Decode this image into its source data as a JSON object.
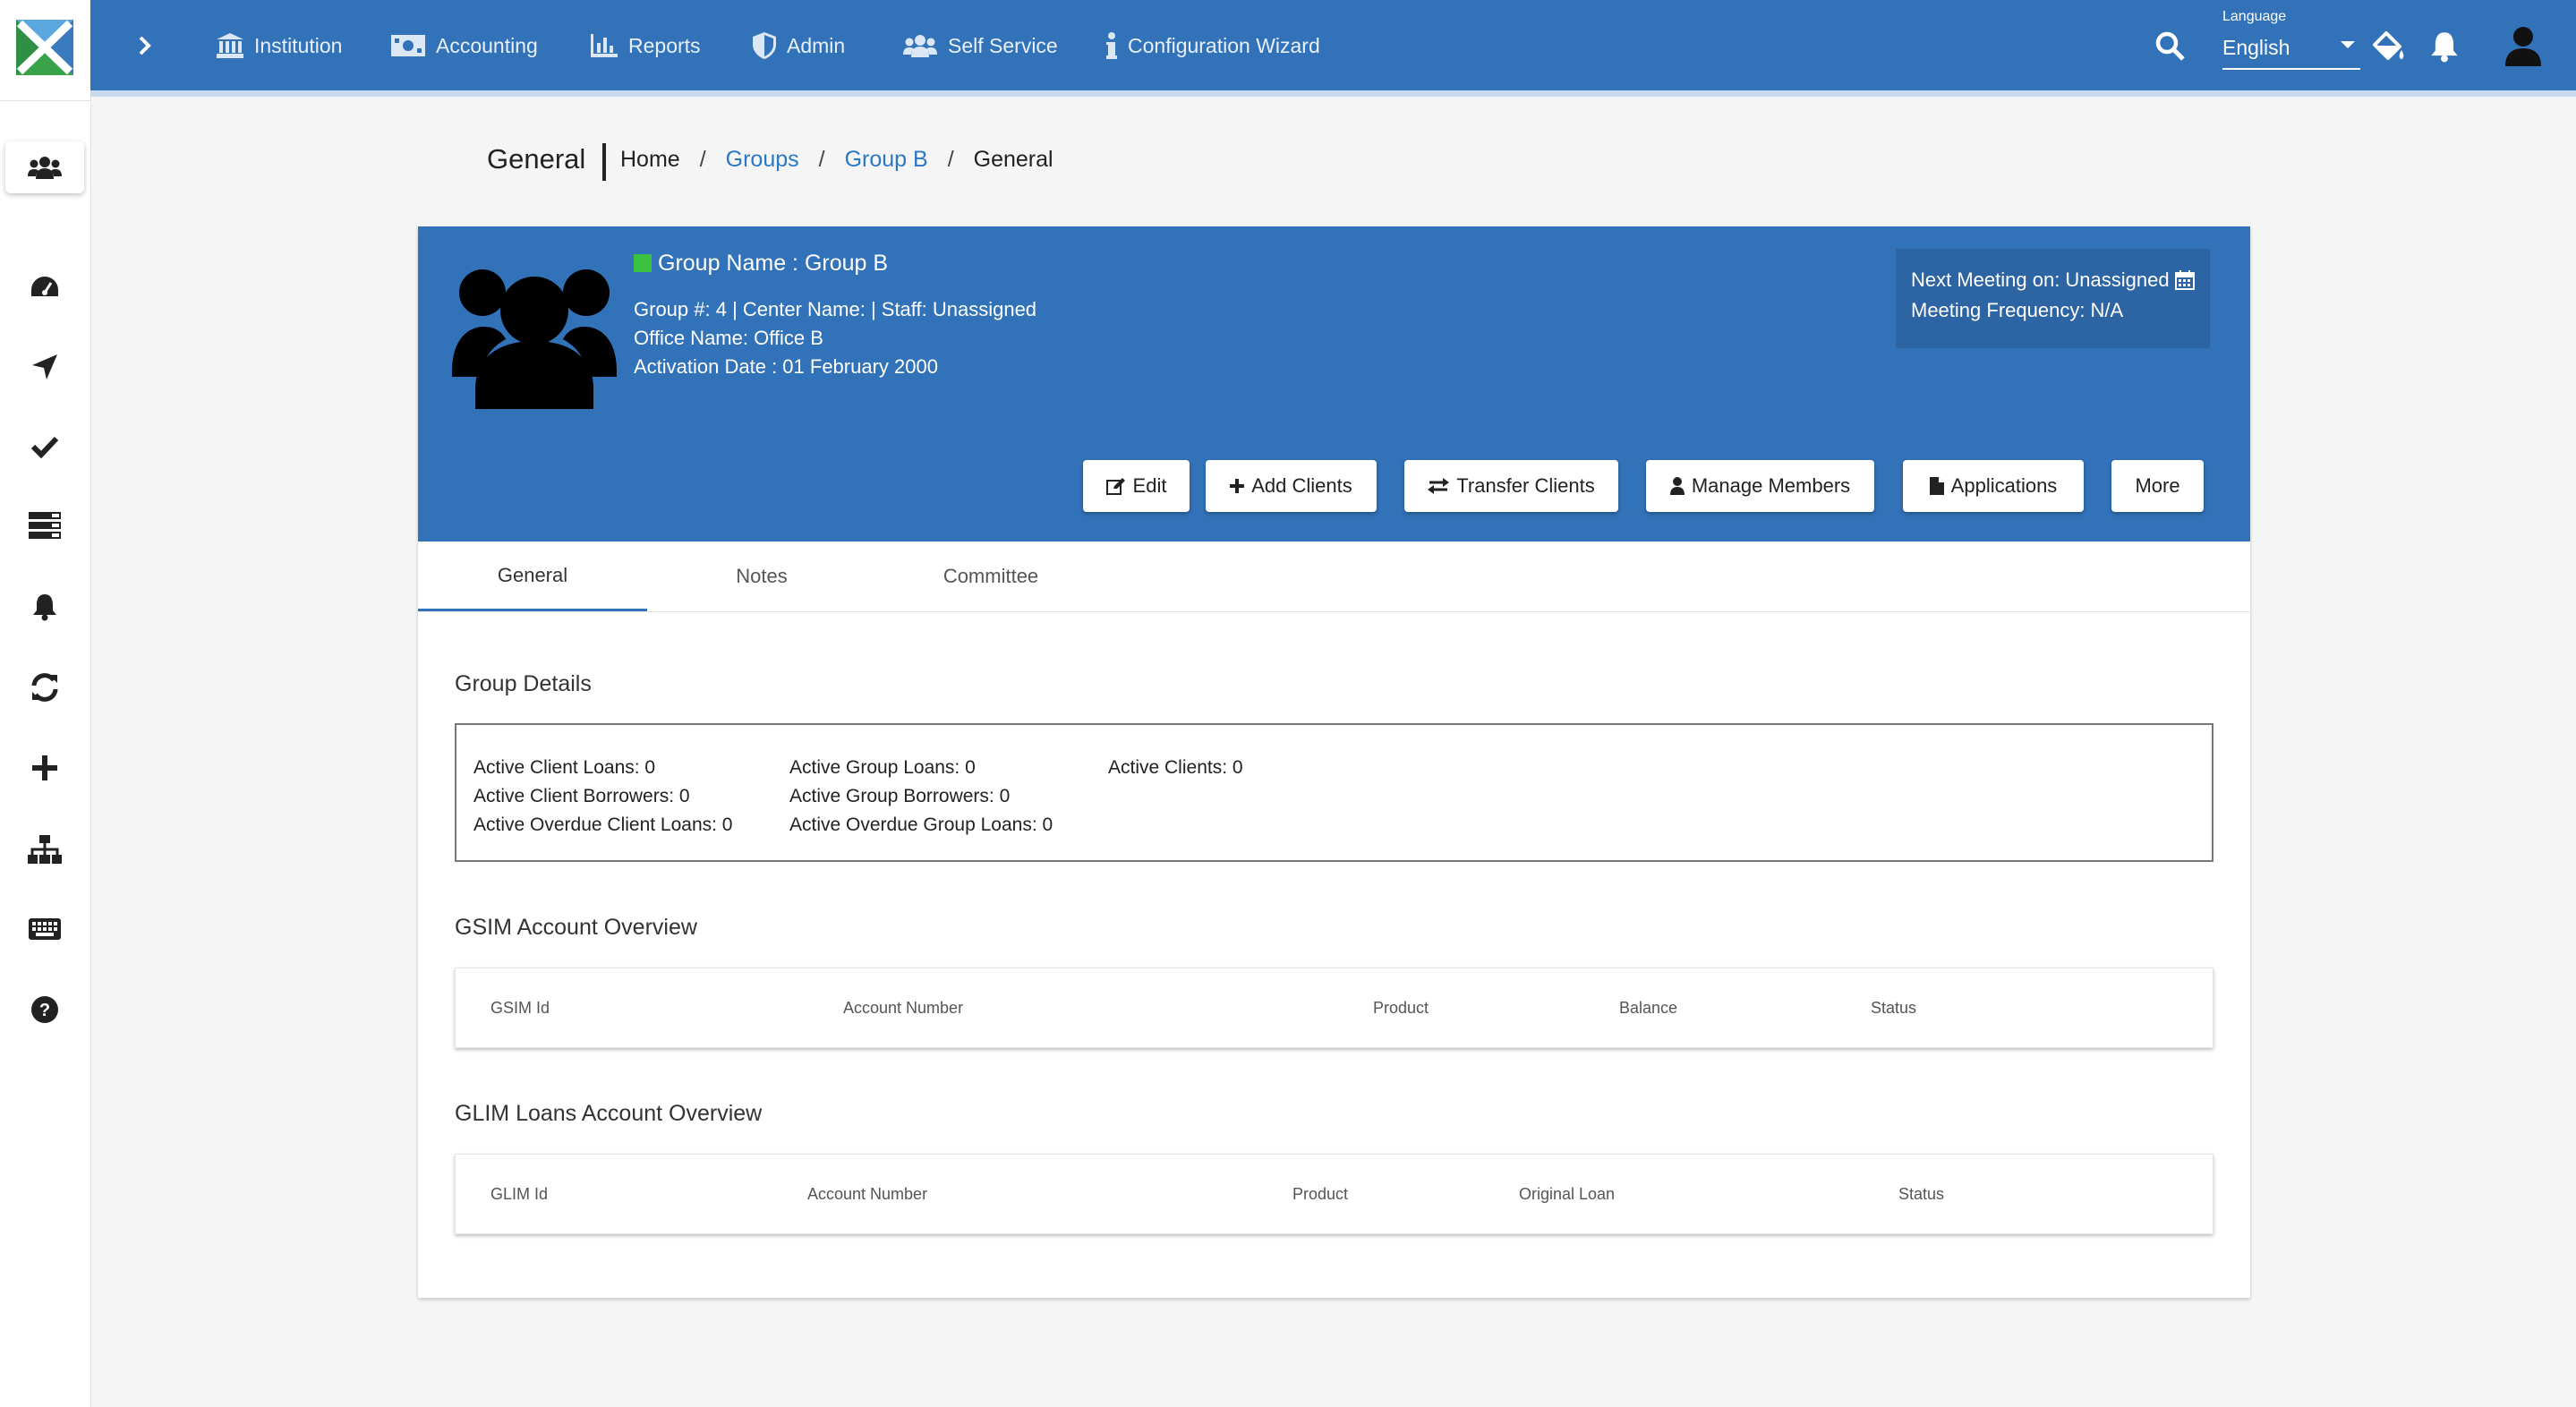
{
  "topbar": {
    "nav": [
      {
        "label": "Institution",
        "icon": "institution-icon"
      },
      {
        "label": "Accounting",
        "icon": "money-icon"
      },
      {
        "label": "Reports",
        "icon": "bar-chart-icon"
      },
      {
        "label": "Admin",
        "icon": "shield-icon"
      },
      {
        "label": "Self Service",
        "icon": "users-icon"
      },
      {
        "label": "Configuration Wizard",
        "icon": "info-icon"
      }
    ],
    "language_label": "Language",
    "language_value": "English"
  },
  "sidebar": {
    "icons": [
      "users-icon",
      "dashboard-icon",
      "navigate-icon",
      "check-icon",
      "list-icon",
      "bell-icon",
      "sync-icon",
      "plus-icon",
      "sitemap-icon",
      "keyboard-icon",
      "help-icon"
    ]
  },
  "page": {
    "title": "General",
    "breadcrumb": [
      "Home",
      "Groups",
      "Group B",
      "General"
    ]
  },
  "group": {
    "name_line": "Group Name : Group B",
    "line1": "Group #: 4 | Center Name: | Staff: Unassigned",
    "line2": "Office Name: Office B",
    "line3": "Activation Date : 01 February 2000",
    "next_meeting": "Next Meeting on: Unassigned",
    "meeting_frequency": "Meeting Frequency: N/A",
    "status_color": "#3ac23f"
  },
  "actions": {
    "edit": "Edit",
    "add_clients": "Add Clients",
    "transfer_clients": "Transfer Clients",
    "manage_members": "Manage Members",
    "applications": "Applications",
    "more": "More"
  },
  "tabs": [
    "General",
    "Notes",
    "Committee"
  ],
  "group_details": {
    "title": "Group Details",
    "col1": [
      "Active Client Loans: 0",
      "Active Client Borrowers: 0",
      "Active Overdue Client Loans: 0"
    ],
    "col2": [
      "Active Group Loans: 0",
      "Active Group Borrowers: 0",
      "Active Overdue Group Loans: 0"
    ],
    "col3": [
      "Active Clients: 0"
    ]
  },
  "gsim": {
    "title": "GSIM Account Overview",
    "headers": [
      "GSIM Id",
      "Account Number",
      "Product",
      "Balance",
      "Status"
    ]
  },
  "glim": {
    "title": "GLIM Loans Account Overview",
    "headers": [
      "GLIM Id",
      "Account Number",
      "Product",
      "Original Loan",
      "Status"
    ]
  },
  "colors": {
    "primary": "#3272b9",
    "link": "#2b78c5"
  }
}
